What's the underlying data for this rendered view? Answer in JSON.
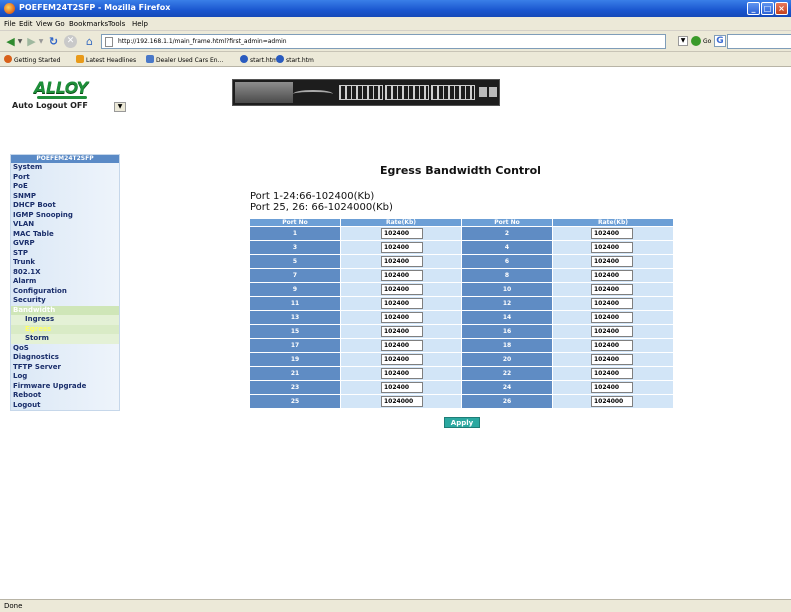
{
  "window": {
    "title": "POEFEM24T2SFP - Mozilla Firefox"
  },
  "menu": [
    "File",
    "Edit",
    "View",
    "Go",
    "Bookmarks",
    "Tools",
    "Help"
  ],
  "navigation": {
    "url": "http://192.168.1.1/main_frame.html?first_admin=admin",
    "go_label": "Go"
  },
  "bookmarks": [
    {
      "label": "Getting Started",
      "icon": "firefox-icon",
      "color": "#d8601a"
    },
    {
      "label": "Latest Headlines",
      "icon": "rss-icon",
      "color": "#e89a1a"
    },
    {
      "label": "Dealer Used Cars En...",
      "icon": "page-icon",
      "color": "#4a78c8"
    },
    {
      "label": "start.htm",
      "icon": "globe-icon",
      "color": "#2a5bbf"
    },
    {
      "label": "start.htm",
      "icon": "globe-icon",
      "color": "#2a5bbf"
    }
  ],
  "header": {
    "logo": "ALLOY",
    "auto_logout": "Auto Logout OFF"
  },
  "sidebar": {
    "title": "POEFEM24T2SFP",
    "items": [
      "System",
      "Port",
      "PoE",
      "SNMP",
      "DHCP Boot",
      "IGMP Snooping",
      "VLAN",
      "MAC Table",
      "GVRP",
      "STP",
      "Trunk",
      "802.1X",
      "Alarm",
      "Configuration",
      "Security",
      "Bandwidth"
    ],
    "sub_items": [
      "Ingress",
      "Egress",
      "Storm"
    ],
    "items_after": [
      "QoS",
      "Diagnostics",
      "TFTP Server",
      "Log",
      "Firmware Upgrade",
      "Reboot",
      "Logout"
    ]
  },
  "main": {
    "title": "Egress Bandwidth Control",
    "note_1": "Port 1-24:66-102400(Kb)",
    "note_2": "Port 25, 26: 66-1024000(Kb)",
    "columns": [
      "Port No",
      "Rate(Kb)",
      "Port No",
      "Rate(Kb)"
    ],
    "rows": [
      [
        "1",
        "102400",
        "2",
        "102400"
      ],
      [
        "3",
        "102400",
        "4",
        "102400"
      ],
      [
        "5",
        "102400",
        "6",
        "102400"
      ],
      [
        "7",
        "102400",
        "8",
        "102400"
      ],
      [
        "9",
        "102400",
        "10",
        "102400"
      ],
      [
        "11",
        "102400",
        "12",
        "102400"
      ],
      [
        "13",
        "102400",
        "14",
        "102400"
      ],
      [
        "15",
        "102400",
        "16",
        "102400"
      ],
      [
        "17",
        "102400",
        "18",
        "102400"
      ],
      [
        "19",
        "102400",
        "20",
        "102400"
      ],
      [
        "21",
        "102400",
        "22",
        "102400"
      ],
      [
        "23",
        "102400",
        "24",
        "102400"
      ],
      [
        "25",
        "1024000",
        "26",
        "1024000"
      ]
    ],
    "apply_label": "Apply"
  },
  "status": "Done",
  "colors": {
    "accent": "#5f8cc4",
    "header": "#6c9fd6",
    "rate_cell": "#d2e5f7",
    "apply": "#2ba8a0",
    "logo": "#1e8f3a"
  }
}
